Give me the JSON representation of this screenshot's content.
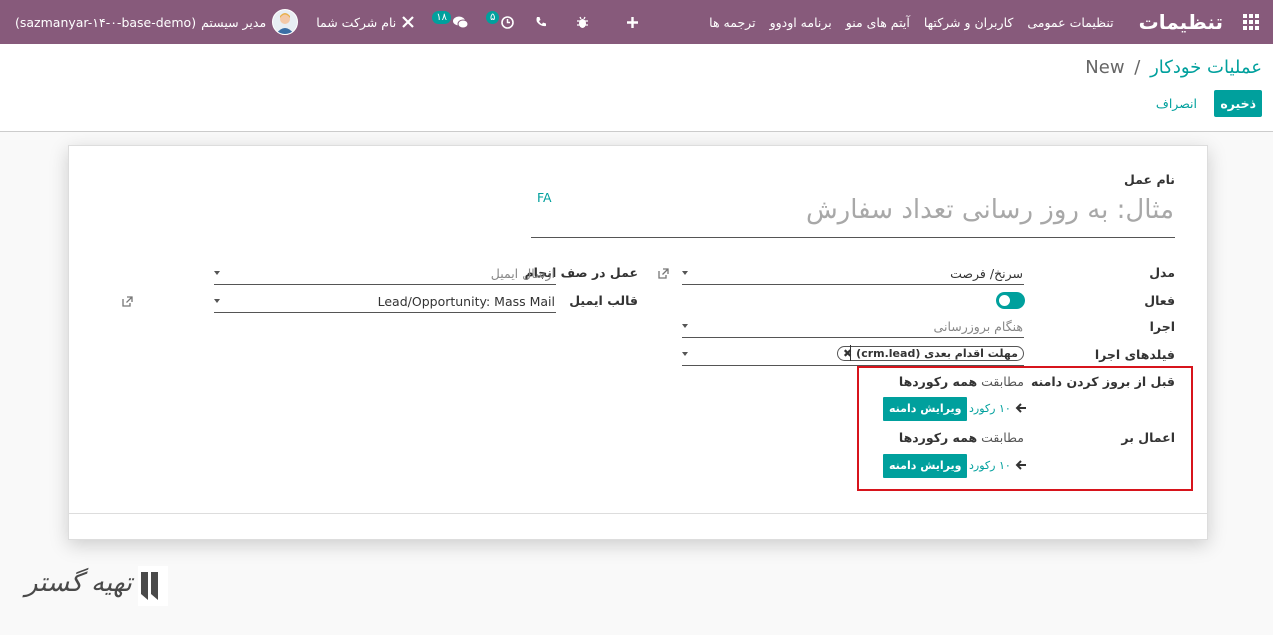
{
  "navbar": {
    "brand": "تنظیمات",
    "menu": [
      "تنظیمات عمومی",
      "کاربران و شرکتها",
      "آیتم های منو",
      "برنامه اودوو",
      "ترجمه ها"
    ],
    "database": "(sazmanyar-۱۴-۰-base-demo)",
    "user_name": "مدیر سیستم",
    "company_name": "نام شرکت شما",
    "messages_badge": "۱۸",
    "activities_badge": "۵"
  },
  "control": {
    "breadcrumb_parent": "عملیات خودکار",
    "breadcrumb_separator": "/",
    "breadcrumb_current": "New",
    "save_label": "ذخیره",
    "discard_label": "انصراف"
  },
  "form": {
    "name_label": "نام عمل",
    "lang_badge": "FA",
    "name_placeholder": "مثال: به روز رسانی تعداد سفارش",
    "model_label": "مدل",
    "model_value": "سرنخ/ فرصت",
    "active_label": "فعال",
    "trigger_label": "اجرا",
    "trigger_value": "هنگام بروزرسانی",
    "trigger_fields_label": "فیلدهای اجرا",
    "trigger_field_tag": "مهلت اقدام بعدی (crm.lead)",
    "action_label": "عمل در صف انجام",
    "action_value": "ارسال ایمیل",
    "template_label": "قالب ایمیل",
    "template_value": "Lead/Opportunity: Mass Mail",
    "before_domain_label": "قبل از بروز کردن دامنه",
    "before_domain_prefix": "مطابقت",
    "before_domain_value": "همه رکوردها",
    "before_records_link": "۱۰ رکورد",
    "before_edit_button": "ویرایش دامنه",
    "apply_on_label": "اعمال بر",
    "apply_domain_prefix": "مطابقت",
    "apply_domain_value": "همه رکوردها",
    "apply_records_link": "۱۰ رکورد",
    "apply_edit_button": "ویرایش دامنه"
  },
  "watermark": {
    "text": "تهیه گستر"
  },
  "colors": {
    "navbar": "#875a7b",
    "accent": "#00a09d",
    "highlight_border": "#d7141c"
  }
}
